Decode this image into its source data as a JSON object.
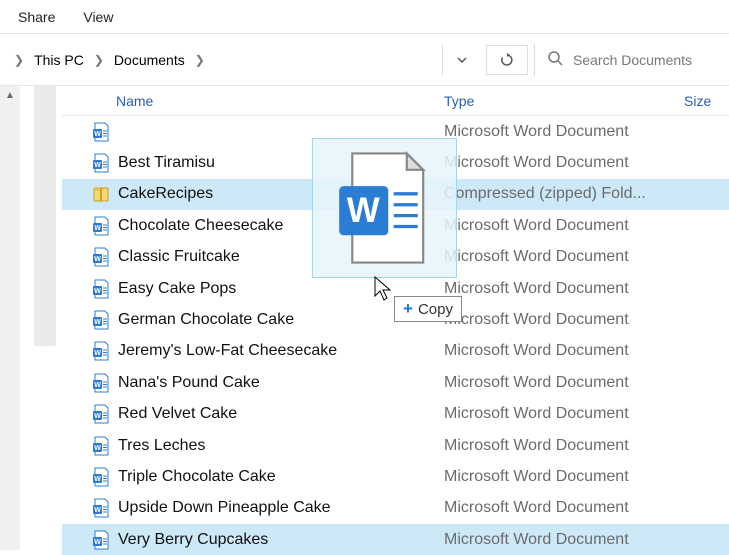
{
  "menu": {
    "share": "Share",
    "view": "View"
  },
  "breadcrumbs": {
    "pc": "This PC",
    "docs": "Documents"
  },
  "search": {
    "placeholder": "Search Documents"
  },
  "headers": {
    "name": "Name",
    "type": "Type",
    "size": "Size"
  },
  "types": {
    "word": "Microsoft Word Document",
    "zip": "Compressed (zipped) Fold..."
  },
  "drag": {
    "copy_label": "Copy"
  },
  "rows": [
    {
      "name": "",
      "type": "word",
      "icon": "word",
      "cut": true
    },
    {
      "name": "Best Tiramisu",
      "type": "word",
      "icon": "word"
    },
    {
      "name": "CakeRecipes",
      "type": "zip",
      "icon": "zip",
      "selected": true
    },
    {
      "name": "Chocolate Cheesecake",
      "type": "word",
      "icon": "word"
    },
    {
      "name": "Classic Fruitcake",
      "type": "word",
      "icon": "word"
    },
    {
      "name": "Easy Cake Pops",
      "type": "word",
      "icon": "word"
    },
    {
      "name": "German Chocolate Cake",
      "type": "word",
      "icon": "word"
    },
    {
      "name": "Jeremy's Low-Fat Cheesecake",
      "type": "word",
      "icon": "word"
    },
    {
      "name": "Nana's Pound Cake",
      "type": "word",
      "icon": "word"
    },
    {
      "name": "Red Velvet Cake",
      "type": "word",
      "icon": "word"
    },
    {
      "name": "Tres Leches",
      "type": "word",
      "icon": "word"
    },
    {
      "name": "Triple Chocolate Cake",
      "type": "word",
      "icon": "word"
    },
    {
      "name": "Upside Down Pineapple Cake",
      "type": "word",
      "icon": "word"
    },
    {
      "name": "Very Berry Cupcakes",
      "type": "word",
      "icon": "word",
      "selected": true
    }
  ]
}
